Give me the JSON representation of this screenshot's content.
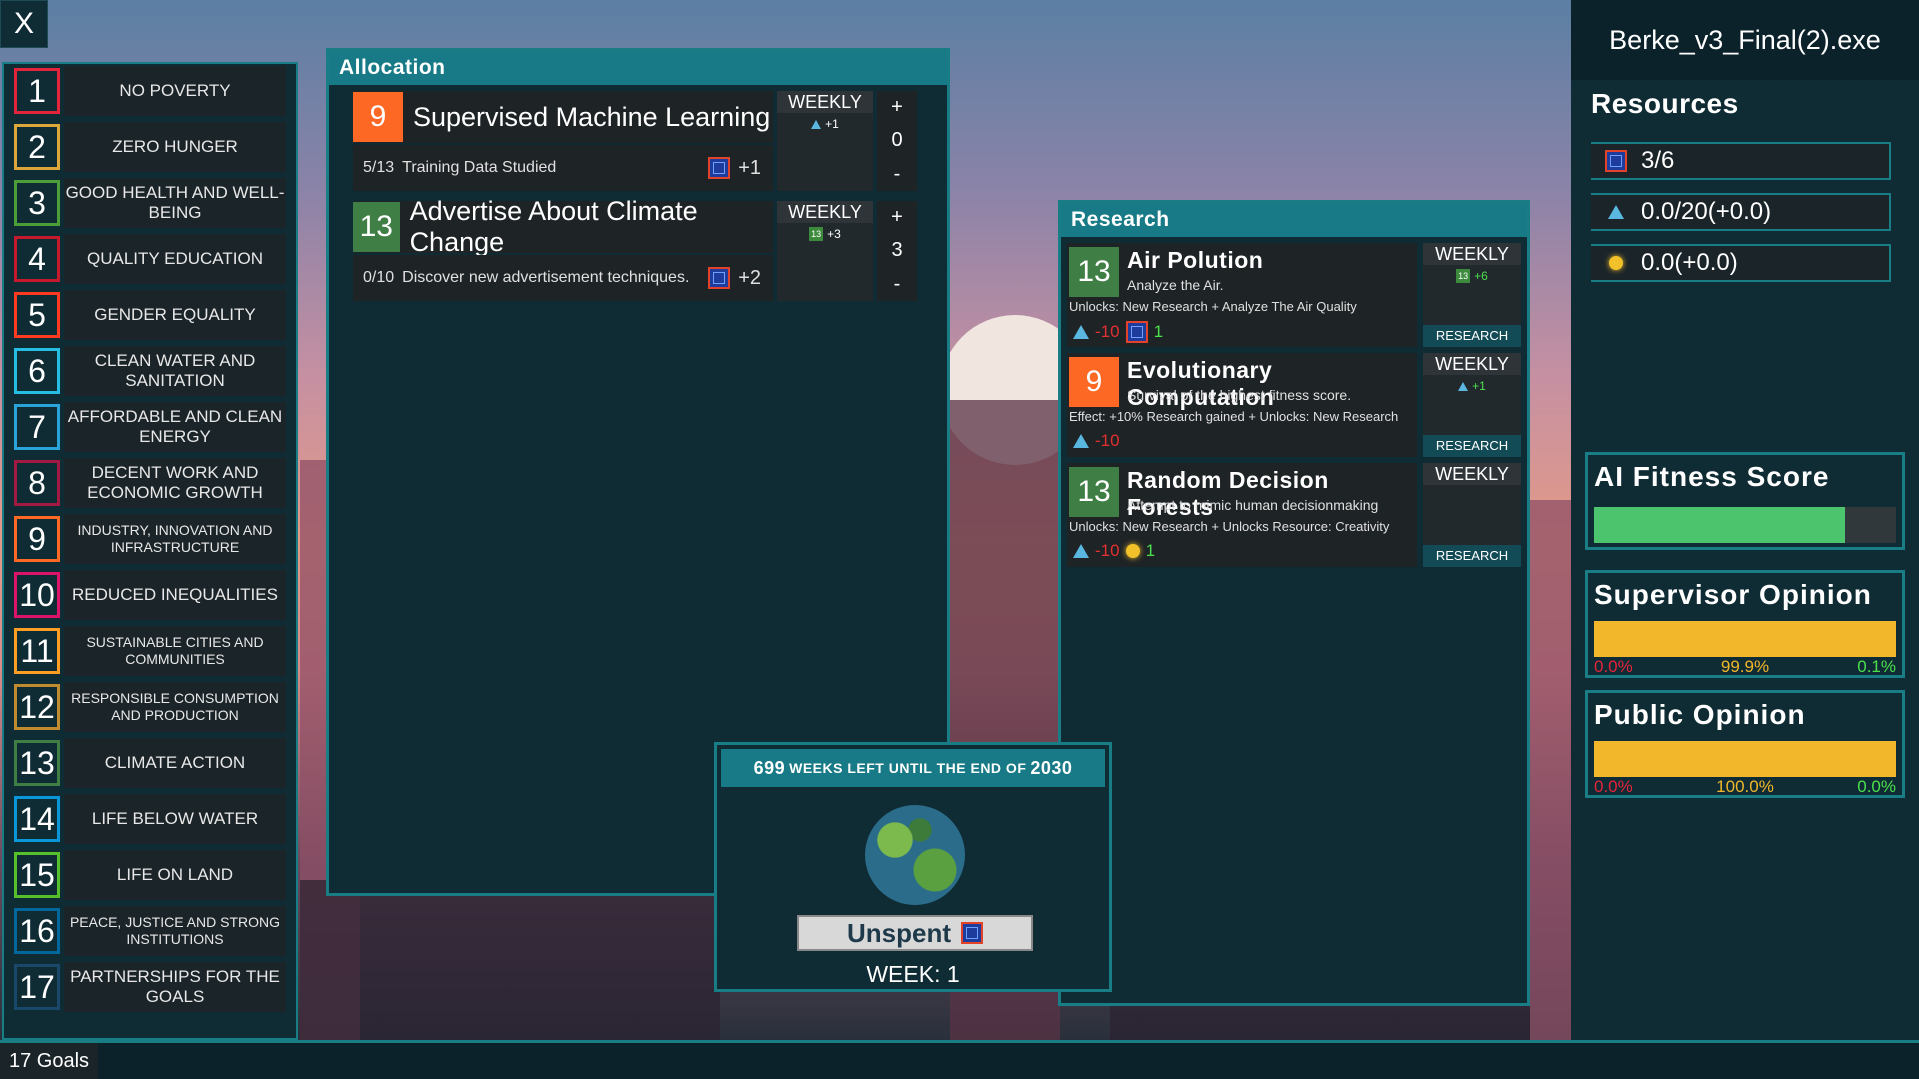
{
  "close_label": "X",
  "goals": [
    {
      "n": "1",
      "label": "NO POVERTY",
      "color": "#e5243b"
    },
    {
      "n": "2",
      "label": "ZERO HUNGER",
      "color": "#dda63a"
    },
    {
      "n": "3",
      "label": "GOOD HEALTH AND WELL-BEING",
      "color": "#4c9f38"
    },
    {
      "n": "4",
      "label": "QUALITY EDUCATION",
      "color": "#c5192d"
    },
    {
      "n": "5",
      "label": "GENDER EQUALITY",
      "color": "#ff3a21"
    },
    {
      "n": "6",
      "label": "CLEAN WATER AND SANITATION",
      "color": "#26bde2"
    },
    {
      "n": "7",
      "label": "AFFORDABLE AND CLEAN ENERGY",
      "color": "#2aa3d9"
    },
    {
      "n": "8",
      "label": "DECENT WORK AND ECONOMIC GROWTH",
      "color": "#a21942"
    },
    {
      "n": "9",
      "label": "INDUSTRY, INNOVATION AND INFRASTRUCTURE",
      "color": "#fd6925"
    },
    {
      "n": "10",
      "label": "REDUCED INEQUALITIES",
      "color": "#dd1367"
    },
    {
      "n": "11",
      "label": "SUSTAINABLE CITIES AND COMMUNITIES",
      "color": "#fd9d24"
    },
    {
      "n": "12",
      "label": "RESPONSIBLE CONSUMPTION AND PRODUCTION",
      "color": "#bf8b2e"
    },
    {
      "n": "13",
      "label": "CLIMATE ACTION",
      "color": "#3f7e44"
    },
    {
      "n": "14",
      "label": "LIFE BELOW WATER",
      "color": "#0a97d9"
    },
    {
      "n": "15",
      "label": "LIFE ON LAND",
      "color": "#56c02b"
    },
    {
      "n": "16",
      "label": "PEACE, JUSTICE AND STRONG INSTITUTIONS",
      "color": "#00689d"
    },
    {
      "n": "17",
      "label": "PARTNERSHIPS FOR THE GOALS",
      "color": "#19486a"
    }
  ],
  "allocation": {
    "title": "Allocation",
    "items": [
      {
        "goal": "9",
        "name": "Supervised Machine Learning",
        "progress": "5/13",
        "desc": "Training Data Studied",
        "reward": "+1",
        "weekly_label": "WEEKLY",
        "weekly_value": "+1",
        "weekly_icon": "flask-icon",
        "plus": "+",
        "count": "0",
        "minus": "-"
      },
      {
        "goal": "13",
        "name": "Advertise About Climate Change",
        "progress": "0/10",
        "desc": "Discover new advertisement techniques.",
        "reward": "+2",
        "weekly_label": "WEEKLY",
        "weekly_value": "+3",
        "weekly_badge": "13",
        "plus": "+",
        "count": "3",
        "minus": "-"
      }
    ]
  },
  "research": {
    "title": "Research",
    "items": [
      {
        "goal": "13",
        "name": "Air Polution",
        "desc": "Analyze the Air.",
        "unlocks": "Unlocks: New Research + Analyze The Air Quality",
        "cost": "-10",
        "gain": "1",
        "gain_icon": "chip-icon",
        "weekly_label": "WEEKLY",
        "weekly_value": "+6",
        "weekly_badge": "13",
        "button": "RESEARCH"
      },
      {
        "goal": "9",
        "name": "Evolutionary Computation",
        "desc": "Survival of the highest fitness score.",
        "unlocks": "Effect: +10% Research gained + Unlocks: New Research",
        "cost": "-10",
        "gain": "",
        "weekly_label": "WEEKLY",
        "weekly_value": "+1",
        "weekly_icon": "flask-icon",
        "button": "RESEARCH"
      },
      {
        "goal": "13",
        "name": "Random Decision Forests",
        "desc": "Attempt to mimic human decisionmaking",
        "unlocks": "Unlocks: New Research + Unlocks Resource: Creativity",
        "cost": "-10",
        "gain": "1",
        "gain_icon": "bulb-icon",
        "weekly_label": "WEEKLY",
        "weekly_value": "",
        "button": "RESEARCH"
      }
    ]
  },
  "week_panel": {
    "weeks_number": "699",
    "weeks_text": "weeks left until the end of",
    "year": "2030",
    "unspent_label": "Unspent",
    "week_label": "WEEK: 1"
  },
  "sidebar": {
    "exe_title": "Berke_v3_Final(2).exe",
    "resources_heading": "Resources",
    "resources": [
      {
        "icon": "chip-icon",
        "value": "3/6"
      },
      {
        "icon": "flask-icon",
        "value": "0.0/20(+0.0)"
      },
      {
        "icon": "bulb-icon",
        "value": "0.0(+0.0)"
      }
    ],
    "ai_fitness": {
      "title": "AI Fitness Score",
      "fraction": 0.83,
      "color": "#4cc46e"
    },
    "supervisor": {
      "title": "Supervisor Opinion",
      "fraction": 1.0,
      "color": "#f2b72a",
      "neg": "0.0%",
      "mid": "99.9%",
      "pos": "0.1%"
    },
    "public": {
      "title": "Public Opinion",
      "fraction": 1.0,
      "color": "#f2b72a",
      "neg": "0.0%",
      "mid": "100.0%",
      "pos": "0.0%"
    }
  },
  "footer": {
    "tab": "17 Goals"
  },
  "colors": {
    "panel": "#0f2b34",
    "accent": "#197d86",
    "negative": "#e43030",
    "positive": "#4ce04c"
  }
}
